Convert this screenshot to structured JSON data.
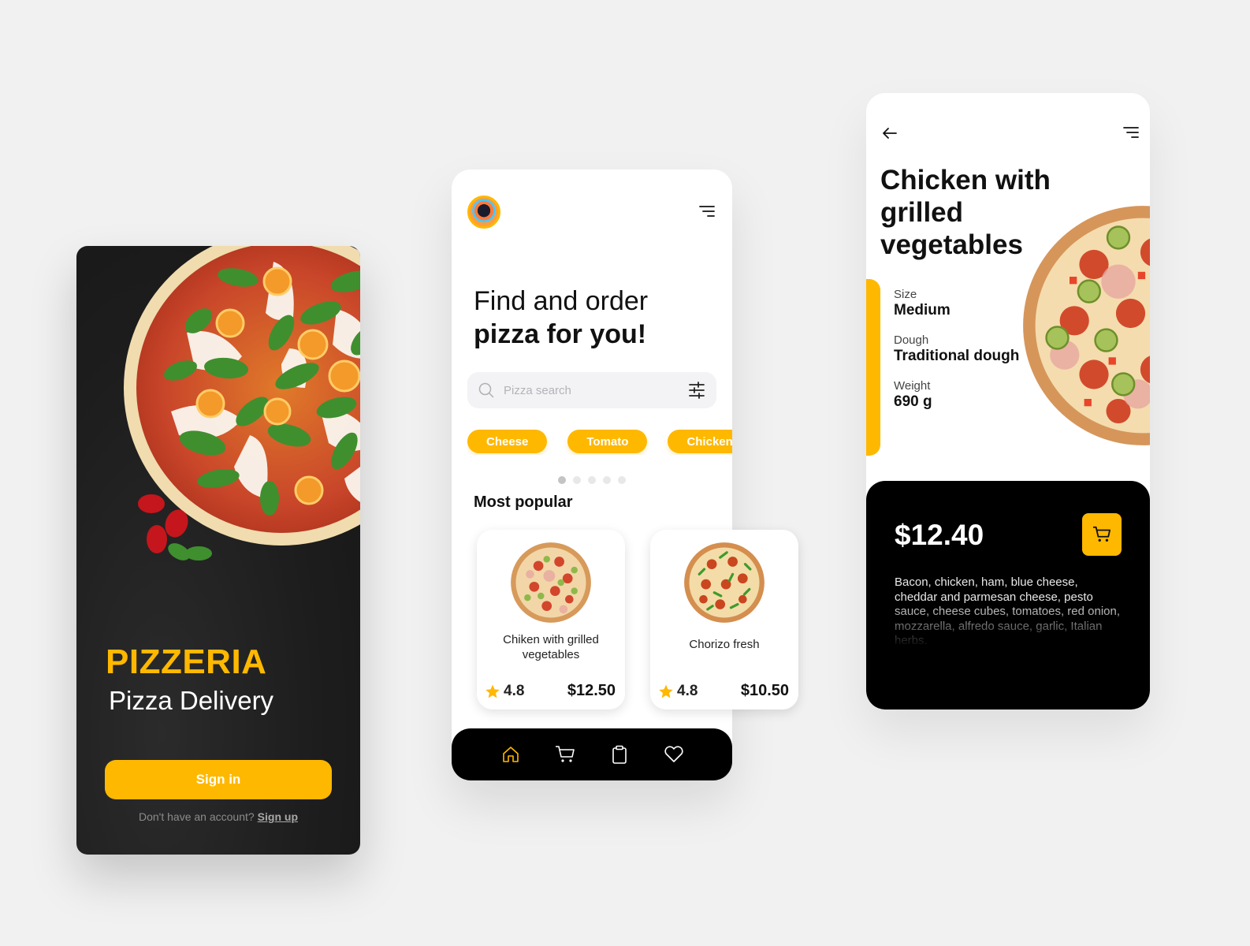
{
  "colors": {
    "accent": "#ffb800",
    "dark": "#000000",
    "background": "#f1f1f1"
  },
  "splash": {
    "brand": "PIZZERIA",
    "tagline": "Pizza Delivery",
    "signin_label": "Sign in",
    "no_account_text": "Don't have an account?",
    "signup_label": "Sign up",
    "hero_image": "margherita-pizza-photo"
  },
  "home": {
    "avatar": "user-avatar",
    "menu_icon": "menu-icon",
    "headline_line1": "Find and order",
    "headline_line2": "pizza for you!",
    "search": {
      "placeholder": "Pizza search",
      "value": "",
      "icon": "search-icon",
      "filter_icon": "filter-sliders-icon"
    },
    "categories": [
      {
        "label": "Cheese"
      },
      {
        "label": "Tomato"
      },
      {
        "label": "Chicken"
      }
    ],
    "carousel": {
      "total": 5,
      "active_index": 0
    },
    "section_title": "Most popular",
    "products": [
      {
        "name": "Chiken with grilled vegetables",
        "rating": "4.8",
        "price": "$12.50"
      },
      {
        "name": "Chorizo fresh",
        "rating": "4.8",
        "price": "$10.50"
      }
    ],
    "navbar": [
      {
        "name": "home",
        "icon": "home-icon",
        "active": true
      },
      {
        "name": "cart",
        "icon": "cart-icon",
        "active": false
      },
      {
        "name": "orders",
        "icon": "clipboard-icon",
        "active": false
      },
      {
        "name": "favorites",
        "icon": "heart-icon",
        "active": false
      }
    ]
  },
  "detail": {
    "title": "Chicken with grilled vegetables",
    "specs": [
      {
        "label": "Size",
        "value": "Medium"
      },
      {
        "label": "Dough",
        "value": "Traditional dough"
      },
      {
        "label": "Weight",
        "value": "690 g"
      }
    ],
    "price": "$12.40",
    "description": "Bacon, chicken, ham, blue cheese, cheddar and parmesan cheese, pesto sauce, cheese cubes, tomatoes, red onion, mozzarella, alfredo sauce, garlic, Italian herbs."
  }
}
